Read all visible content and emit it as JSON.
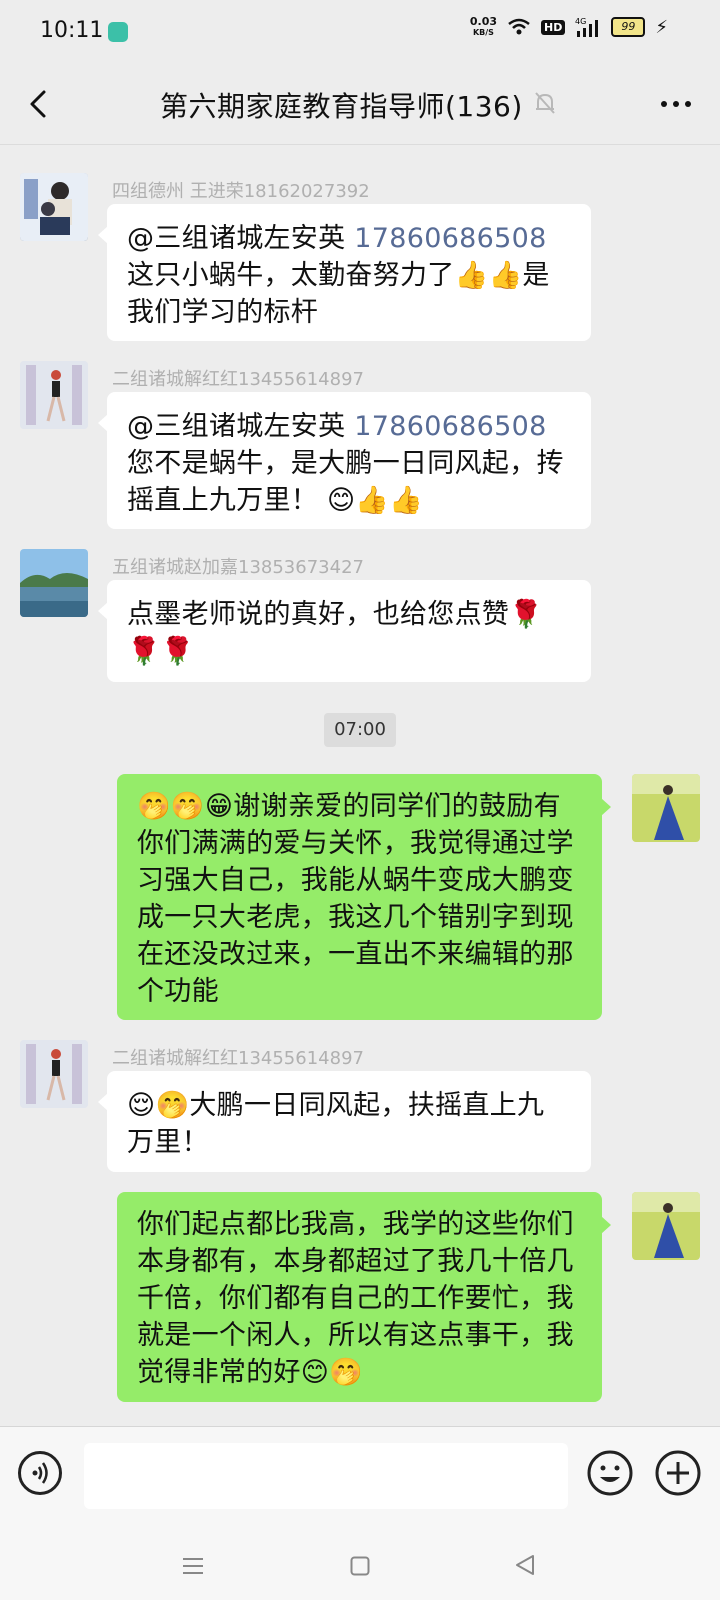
{
  "status_bar": {
    "time": "10:11",
    "net_speed_value": "0.03",
    "net_speed_unit": "KB/S",
    "hd": "HD",
    "network": "4G",
    "battery": "99"
  },
  "header": {
    "title": "第六期家庭教育指导师(136)"
  },
  "messages": [
    {
      "sender": "四组德州 王进荣18162027392",
      "text_before": "@三组诸城左安英 ",
      "phone": "17860686508",
      "text_after": " 这只小蜗牛，太勤奋努力了👍👍是我们学习的标杆"
    },
    {
      "sender": "二组诸城解红红13455614897",
      "text_before": "@三组诸城左安英 ",
      "phone": "17860686508",
      "text_after": " 您不是蜗牛，是大鹏一日同风起，抟摇直上九万里！ 😊👍👍"
    },
    {
      "sender": "五组诸城赵加嘉13853673427",
      "text": "点墨老师说的真好，也给您点赞🌹🌹🌹"
    },
    {
      "self": true,
      "text": "🤭🤭😁谢谢亲爱的同学们的鼓励有你们满满的爱与关怀，我觉得通过学习强大自己，我能从蜗牛变成大鹏变成一只大老虎，我这几个错别字到现在还没改过来，一直出不来编辑的那个功能"
    },
    {
      "sender": "二组诸城解红红13455614897",
      "text": "😌🤭大鹏一日同风起，扶摇直上九万里！"
    },
    {
      "self": true,
      "text": "你们起点都比我高，我学的这些你们本身都有，本身都超过了我几十倍几千倍，你们都有自己的工作要忙，我就是一个闲人，所以有这点事干，我觉得非常的好😊🤭"
    }
  ],
  "timestamp": "07:00",
  "input": {
    "value": ""
  },
  "colors": {
    "self_bubble": "#95ec69",
    "other_bubble": "#ffffff",
    "background": "#ededed",
    "link": "#576b95"
  }
}
